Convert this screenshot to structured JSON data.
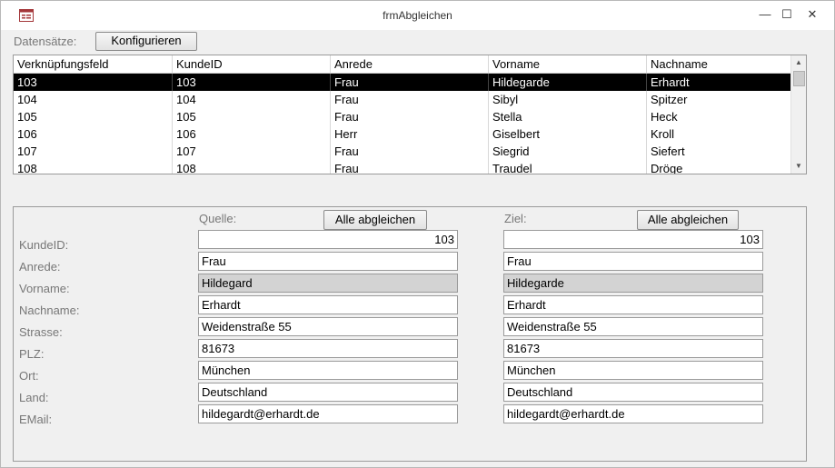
{
  "window": {
    "title": "frmAbgleichen",
    "min_glyph": "—",
    "max_glyph": "☐",
    "close_glyph": "✕"
  },
  "toolbar": {
    "label": "Datensätze:",
    "configure_label": "Konfigurieren"
  },
  "grid": {
    "columns": [
      "Verknüpfungsfeld",
      "KundeID",
      "Anrede",
      "Vorname",
      "Nachname"
    ],
    "rows": [
      [
        "103",
        "103",
        "Frau",
        "Hildegarde",
        "Erhardt"
      ],
      [
        "104",
        "104",
        "Frau",
        "Sibyl",
        "Spitzer"
      ],
      [
        "105",
        "105",
        "Frau",
        "Stella",
        "Heck"
      ],
      [
        "106",
        "106",
        "Herr",
        "Giselbert",
        "Kroll"
      ],
      [
        "107",
        "107",
        "Frau",
        "Siegrid",
        "Siefert"
      ],
      [
        "108",
        "108",
        "Frau",
        "Traudel",
        "Dröge"
      ]
    ],
    "selected_row": 0
  },
  "detail": {
    "source_label": "Quelle:",
    "target_label": "Ziel:",
    "sync_all_label": "Alle abgleichen",
    "field_labels": [
      "KundeID:",
      "Anrede:",
      "Vorname:",
      "Nachname:",
      "Strasse:",
      "PLZ:",
      "Ort:",
      "Land:",
      "EMail:"
    ],
    "source": {
      "kundeid": "103",
      "anrede": "Frau",
      "vorname": "Hildegard",
      "nachname": "Erhardt",
      "strasse": "Weidenstraße 55",
      "plz": "81673",
      "ort": "München",
      "land": "Deutschland",
      "email": "hildegardt@erhardt.de"
    },
    "target": {
      "kundeid": "103",
      "anrede": "Frau",
      "vorname": "Hildegarde",
      "nachname": "Erhardt",
      "strasse": "Weidenstraße 55",
      "plz": "81673",
      "ort": "München",
      "land": "Deutschland",
      "email": "hildegardt@erhardt.de"
    },
    "differing_field": "vorname"
  },
  "colors": {
    "selected_row_bg": "#000000",
    "diff_field_bg": "#d3d3d3",
    "label_text": "#777777"
  }
}
